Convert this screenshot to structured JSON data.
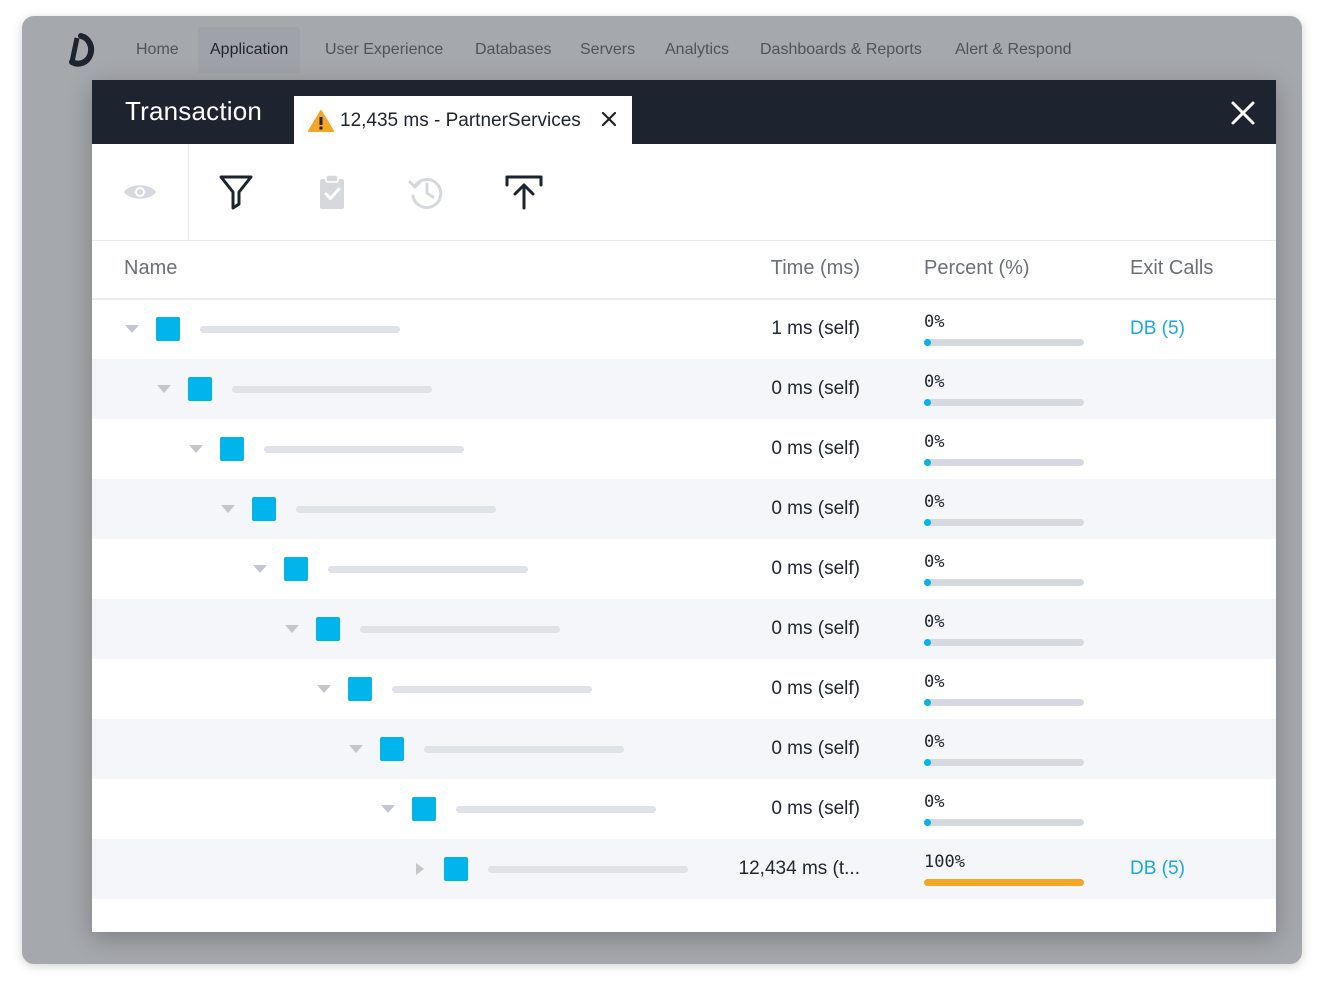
{
  "nav": {
    "items": [
      "Home",
      "Application",
      "User Experience",
      "Databases",
      "Servers",
      "Analytics",
      "Dashboards & Reports",
      "Alert & Respond"
    ],
    "active": "Application"
  },
  "modal": {
    "title": "Transaction",
    "tab_label": "12,435 ms - PartnerServices",
    "tab_icon": "warning-icon"
  },
  "toolbar": {
    "icons": [
      "eye-icon",
      "filter-icon",
      "clipboard-check-icon",
      "history-icon",
      "upload-icon"
    ]
  },
  "table": {
    "headers": {
      "name": "Name",
      "time": "Time (ms)",
      "percent": "Percent (%)",
      "exit": "Exit Calls"
    },
    "rows": [
      {
        "time": "1 ms (self)",
        "percent": "0%",
        "percent_value": 0,
        "exit": "DB (5)",
        "expanded": true
      },
      {
        "time": "0 ms (self)",
        "percent": "0%",
        "percent_value": 0,
        "exit": "",
        "expanded": true
      },
      {
        "time": "0 ms (self)",
        "percent": "0%",
        "percent_value": 0,
        "exit": "",
        "expanded": true
      },
      {
        "time": "0 ms (self)",
        "percent": "0%",
        "percent_value": 0,
        "exit": "",
        "expanded": true
      },
      {
        "time": "0 ms (self)",
        "percent": "0%",
        "percent_value": 0,
        "exit": "",
        "expanded": true
      },
      {
        "time": "0 ms (self)",
        "percent": "0%",
        "percent_value": 0,
        "exit": "",
        "expanded": true
      },
      {
        "time": "0 ms (self)",
        "percent": "0%",
        "percent_value": 0,
        "exit": "",
        "expanded": true
      },
      {
        "time": "0 ms (self)",
        "percent": "0%",
        "percent_value": 0,
        "exit": "",
        "expanded": true
      },
      {
        "time": "0 ms (self)",
        "percent": "0%",
        "percent_value": 0,
        "exit": "",
        "expanded": true
      },
      {
        "time": "12,434 ms (t...",
        "percent": "100%",
        "percent_value": 100,
        "exit": "DB (5)",
        "expanded": false
      }
    ]
  },
  "colors": {
    "header_bg": "#1d2430",
    "accent": "#00b5eb",
    "link": "#1aa9e0",
    "warning": "#f5a623",
    "full_bar": "#f5a623"
  }
}
